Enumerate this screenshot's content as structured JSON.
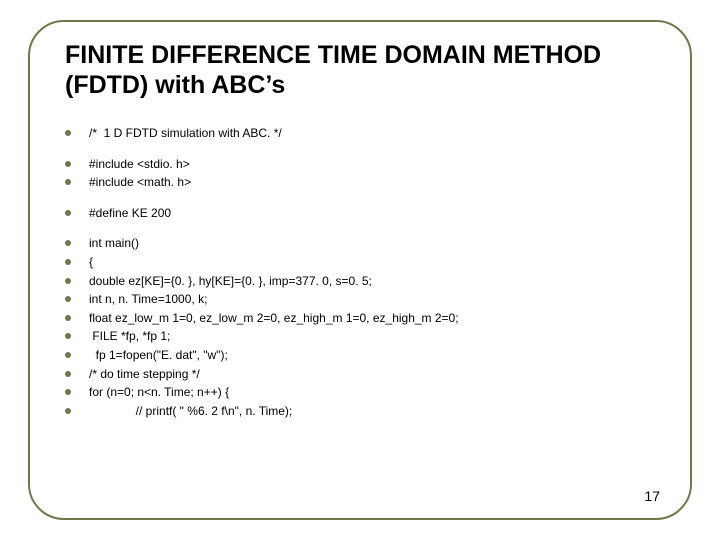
{
  "title": "FINITE DIFFERENCE TIME DOMAIN METHOD (FDTD) with ABC’s",
  "groups": [
    [
      "/*  1 D FDTD simulation with ABC. */"
    ],
    [
      "#include <stdio. h>",
      "#include <math. h>"
    ],
    [
      "#define KE 200"
    ],
    [
      "int main()",
      "{",
      "double ez[KE]={0. }, hy[KE]={0. }, imp=377. 0, s=0. 5;",
      "int n, n. Time=1000, k;",
      "float ez_low_m 1=0, ez_low_m 2=0, ez_high_m 1=0, ez_high_m 2=0;",
      " FILE *fp, *fp 1;",
      "  fp 1=fopen(\"E. dat\", \"w\");",
      "/* do time stepping */",
      "for (n=0; n<n. Time; n++) {",
      "              // printf( \" %6. 2 f\\n\", n. Time);"
    ]
  ],
  "page_number": "17"
}
